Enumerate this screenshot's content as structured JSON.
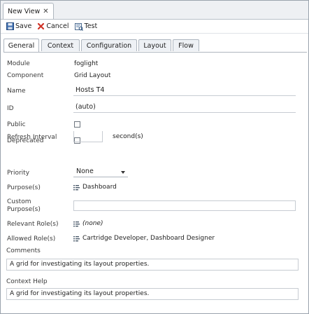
{
  "doc_tab": {
    "title": "New View",
    "close": "✕"
  },
  "toolbar": {
    "save_label": "Save",
    "cancel_label": "Cancel",
    "test_label": "Test"
  },
  "tabs": [
    {
      "label": "General"
    },
    {
      "label": "Context"
    },
    {
      "label": "Configuration"
    },
    {
      "label": "Layout"
    },
    {
      "label": "Flow"
    }
  ],
  "form": {
    "module": {
      "label": "Module",
      "value": "foglight"
    },
    "component": {
      "label": "Component",
      "value": "Grid Layout"
    },
    "name": {
      "label": "Name",
      "value": "Hosts T4"
    },
    "id": {
      "label": "ID",
      "value": "(auto)"
    },
    "public": {
      "label": "Public",
      "checked": false
    },
    "deprecated": {
      "label": "Deprecated",
      "checked": false
    },
    "refresh": {
      "label": "Refresh Interval",
      "value": "",
      "unit": "second(s)"
    },
    "priority": {
      "label": "Priority",
      "value": "None"
    },
    "purposes": {
      "label": "Purpose(s)",
      "value": "Dashboard"
    },
    "custom_purposes": {
      "label_line1": "Custom",
      "label_line2": "Purpose(s)",
      "value": ""
    },
    "relevant_roles": {
      "label": "Relevant Role(s)",
      "value": "(none)"
    },
    "allowed_roles": {
      "label": "Allowed Role(s)",
      "value": "Cartridge Developer, Dashboard Designer"
    },
    "comments": {
      "label": "Comments",
      "value": "A grid for investigating its layout properties."
    },
    "context_help": {
      "label": "Context Help",
      "value": "A grid for investigating its layout properties."
    }
  },
  "colors": {
    "accent_red": "#c0392b",
    "save_blue": "#2e5f9e",
    "border": "#aeb6bf"
  }
}
